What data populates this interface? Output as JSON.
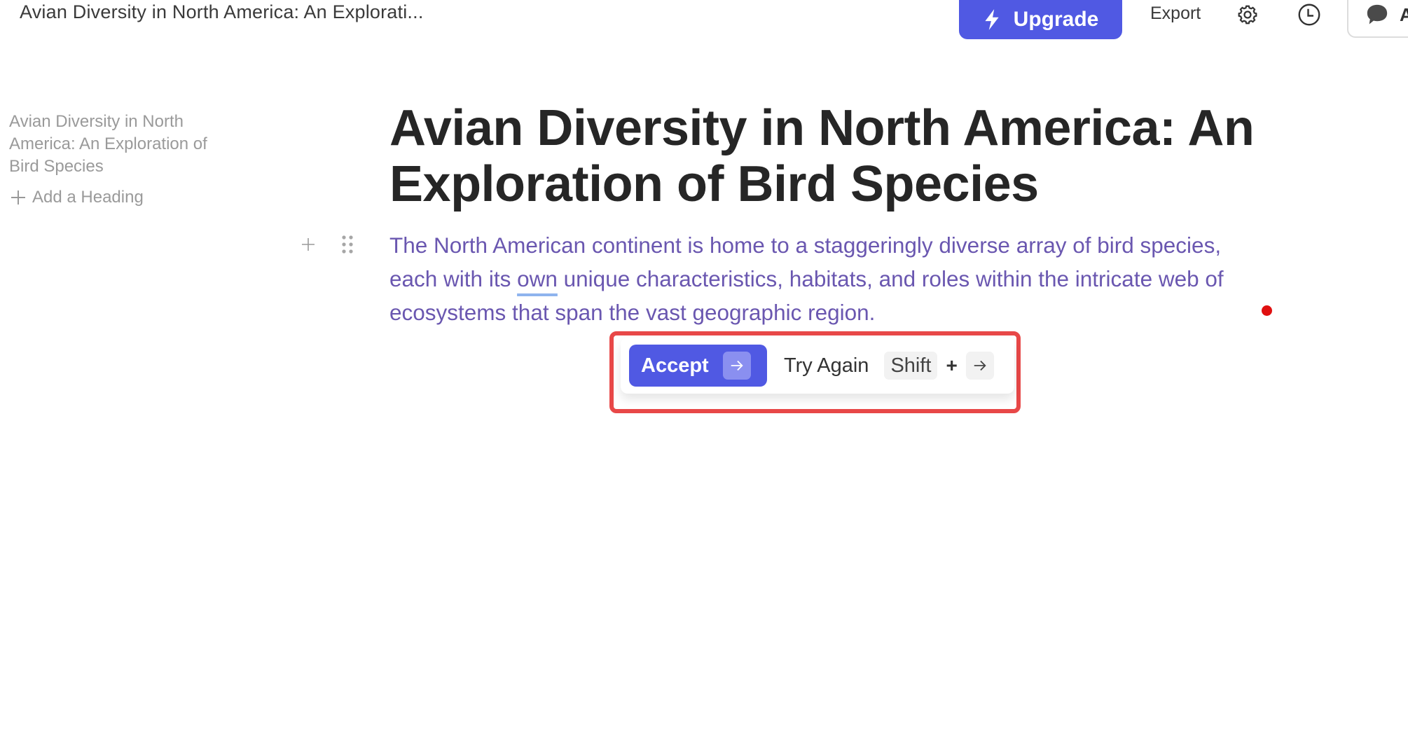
{
  "topbar": {
    "document_title": "Avian Diversity in North America: An Explorati...",
    "upgrade_label": "Upgrade",
    "upgrade_icon": "lightning-icon",
    "export_label": "Export",
    "settings_icon": "gear-icon",
    "history_icon": "clock-icon",
    "comment_icon": "comment-icon",
    "comment_label_partial": "A"
  },
  "sidebar": {
    "outline_items": [
      {
        "label": "Avian Diversity in North America: An Exploration of Bird Species"
      }
    ],
    "add_heading_label": "Add a Heading"
  },
  "document": {
    "title": "Avian Diversity in North America: An Exploration of Bird Species",
    "paragraph": {
      "before_underline": "The North American continent is home to a staggeringly diverse array of bird species, each with its ",
      "underlined_word": "own",
      "after_underline": " unique characteristics, habitats, and roles within the intricate web of ecosystems that span the vast geographic region."
    }
  },
  "suggestion_popup": {
    "accept_label": "Accept",
    "accept_shortcut_icon": "arrow-right-icon",
    "try_again_label": "Try Again",
    "try_again_shortcut": {
      "modifier": "Shift",
      "plus": "+",
      "key_icon": "arrow-right-icon"
    }
  },
  "colors": {
    "accent": "#5059e3",
    "accept_key_bg": "#8a8ff0",
    "paragraph_text": "#6a57b0",
    "highlight_frame": "#e84848",
    "marker_dot": "#e01010",
    "underline": "#8fb4ee"
  }
}
